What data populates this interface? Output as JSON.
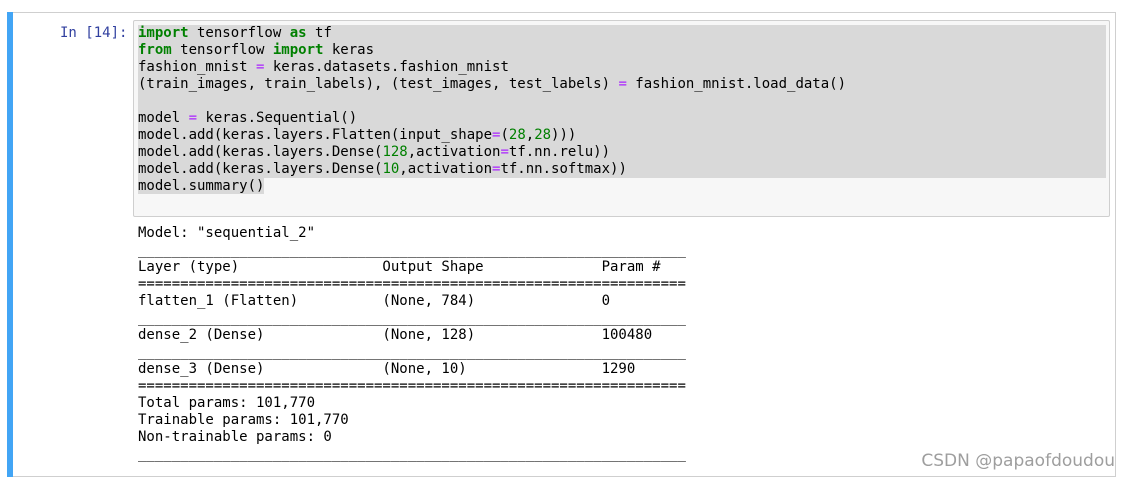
{
  "cell": {
    "prompt": "In [14]:",
    "code_lines": [
      [
        {
          "t": "import",
          "c": "kw"
        },
        {
          "t": " tensorflow ",
          "c": ""
        },
        {
          "t": "as",
          "c": "kw"
        },
        {
          "t": " tf",
          "c": ""
        }
      ],
      [
        {
          "t": "from",
          "c": "kw"
        },
        {
          "t": " tensorflow ",
          "c": ""
        },
        {
          "t": "import",
          "c": "kw"
        },
        {
          "t": " keras",
          "c": ""
        }
      ],
      [
        {
          "t": "fashion_mnist ",
          "c": ""
        },
        {
          "t": "=",
          "c": "op"
        },
        {
          "t": " keras.datasets.fashion_mnist",
          "c": ""
        }
      ],
      [
        {
          "t": "(train_images, train_labels), (test_images, test_labels) ",
          "c": ""
        },
        {
          "t": "=",
          "c": "op"
        },
        {
          "t": " fashion_mnist.load_data()",
          "c": ""
        }
      ],
      [],
      [
        {
          "t": "model ",
          "c": ""
        },
        {
          "t": "=",
          "c": "op"
        },
        {
          "t": " keras.Sequential()",
          "c": ""
        }
      ],
      [
        {
          "t": "model.add(keras.layers.Flatten(input_shape",
          "c": ""
        },
        {
          "t": "=",
          "c": "op"
        },
        {
          "t": "(",
          "c": ""
        },
        {
          "t": "28",
          "c": "num"
        },
        {
          "t": ",",
          "c": ""
        },
        {
          "t": "28",
          "c": "num"
        },
        {
          "t": ")))",
          "c": ""
        }
      ],
      [
        {
          "t": "model.add(keras.layers.Dense(",
          "c": ""
        },
        {
          "t": "128",
          "c": "num"
        },
        {
          "t": ",activation",
          "c": ""
        },
        {
          "t": "=",
          "c": "op"
        },
        {
          "t": "tf.nn.relu))",
          "c": ""
        }
      ],
      [
        {
          "t": "model.add(keras.layers.Dense(",
          "c": ""
        },
        {
          "t": "10",
          "c": "num"
        },
        {
          "t": ",activation",
          "c": ""
        },
        {
          "t": "=",
          "c": "op"
        },
        {
          "t": "tf.nn.softmax))",
          "c": ""
        }
      ],
      [
        {
          "t": "model.summary()",
          "c": ""
        }
      ]
    ],
    "output_lines": [
      "Model: \"sequential_2\"",
      "_________________________________________________________________",
      "Layer (type)                 Output Shape              Param #   ",
      "=================================================================",
      "flatten_1 (Flatten)          (None, 784)               0         ",
      "_________________________________________________________________",
      "dense_2 (Dense)              (None, 128)               100480    ",
      "_________________________________________________________________",
      "dense_3 (Dense)              (None, 10)                1290      ",
      "=================================================================",
      "Total params: 101,770",
      "Trainable params: 101,770",
      "Non-trainable params: 0",
      "_________________________________________________________________"
    ]
  },
  "watermark": "CSDN @papaofdoudou",
  "colors": {
    "cell_bar": "#42a5f5",
    "prompt": "#303f9f",
    "keyword": "#008000",
    "operator": "#aa22ff",
    "number": "#008000"
  }
}
